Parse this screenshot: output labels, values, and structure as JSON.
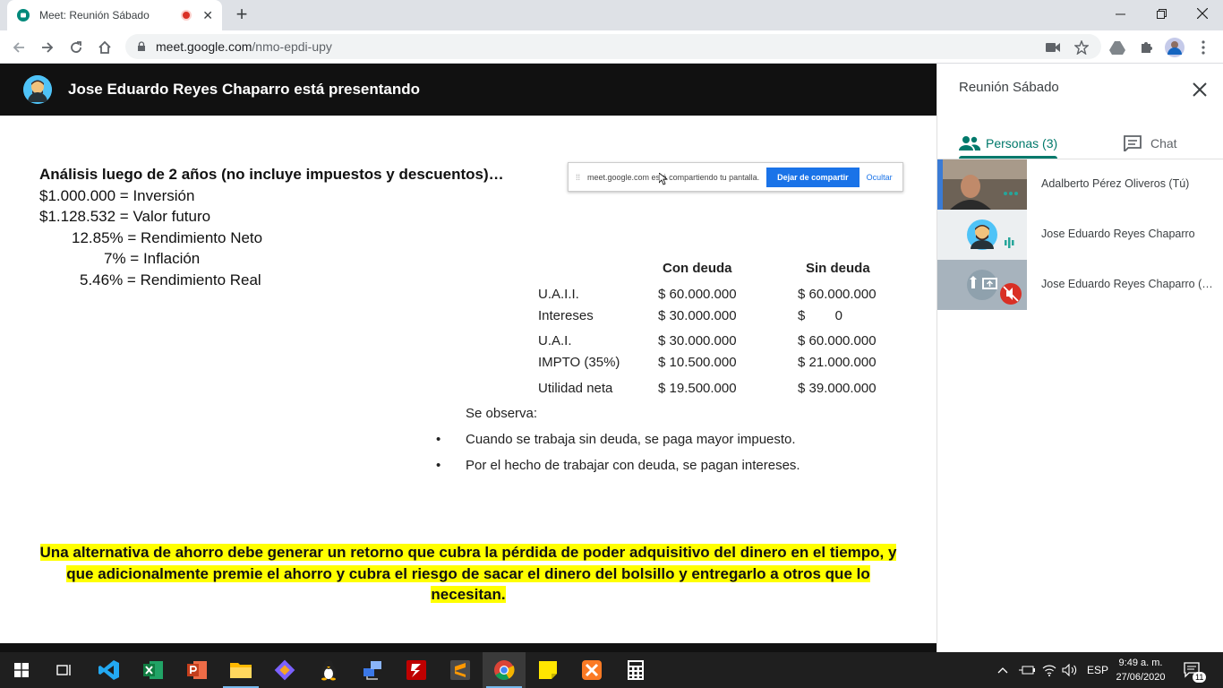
{
  "browser": {
    "tab_title": "Meet: Reunión Sábado",
    "tab_close": "✕",
    "new_tab": "+",
    "url_domain": "meet.google.com",
    "url_path": "/nmo-epdi-upy"
  },
  "presentation": {
    "header_text": "Jose Eduardo Reyes Chaparro está presentando",
    "analysis_title": "Análisis luego de 2 años (no incluye impuestos y descuentos)…",
    "analysis_lines": [
      "$1.000.000  = Inversión",
      "$1.128.532  = Valor futuro",
      "12.85% = Rendimiento Neto",
      "7% = Inflación",
      "5.46% = Rendimiento Real"
    ],
    "share_bar": {
      "text": "meet.google.com está compartiendo tu pantalla.",
      "stop_button": "Dejar de compartir",
      "hide_button": "Ocultar"
    },
    "table": {
      "headers": [
        "Con deuda",
        "Sin deuda"
      ],
      "rows": [
        [
          "U.A.I.I.",
          "$ 60.000.000",
          "$ 60.000.000"
        ],
        [
          "Intereses",
          "$ 30.000.000",
          "$        0"
        ],
        [
          "U.A.I.",
          "$ 30.000.000",
          "$ 60.000.000"
        ],
        [
          "IMPTO (35%)",
          "$ 10.500.000",
          "$ 21.000.000"
        ],
        [
          "Utilidad neta",
          "$ 19.500.000",
          "$ 39.000.000"
        ]
      ]
    },
    "observe": "Se observa:",
    "bullets": [
      "Cuando se trabaja sin deuda, se paga mayor impuesto.",
      "Por el hecho de trabajar con deuda, se pagan intereses."
    ],
    "bullet_char": "•",
    "highlight_lines": [
      "Una alternativa de ahorro debe generar un retorno que cubra la pérdida de poder adquisitivo del dinero en el tiempo, y",
      "que adicionalmente premie el ahorro y cubra el riesgo de sacar el dinero del bolsillo y entregarlo a otros que lo",
      "necesitan."
    ]
  },
  "side_panel": {
    "title": "Reunión Sábado",
    "tab_people": "Personas (3)",
    "tab_chat": "Chat",
    "participants": [
      {
        "name": "Adalberto Pérez Oliveros (Tú)"
      },
      {
        "name": "Jose Eduardo Reyes Chaparro"
      },
      {
        "name": "Jose Eduardo Reyes Chaparro (Presentación)"
      }
    ]
  },
  "taskbar": {
    "language": "ESP",
    "time": "9:49 a. m.",
    "date": "27/06/2020",
    "notification_count": "11"
  },
  "colors": {
    "meet_green": "#00796b",
    "highlight_yellow": "#ffff00",
    "share_blue": "#1a73e8",
    "mute_red": "#d93025"
  }
}
